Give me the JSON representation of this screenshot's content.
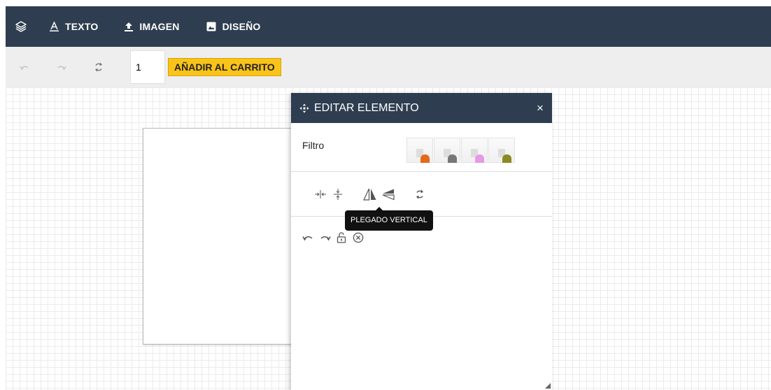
{
  "nav": {
    "layers_icon": "layers-icon",
    "items": [
      {
        "label": "TEXTO",
        "icon": "text-icon"
      },
      {
        "label": "IMAGEN",
        "icon": "upload-icon"
      },
      {
        "label": "DISEÑO",
        "icon": "image-icon"
      }
    ]
  },
  "toolbar": {
    "undo_icon": "undo-icon",
    "redo_icon": "redo-icon",
    "reset_icon": "refresh-icon",
    "quantity_value": "1",
    "cart_label": "AÑADIR AL CARRITO"
  },
  "panel": {
    "title": "EDITAR ELEMENTO",
    "close_label": "×",
    "filter_label": "Filtro",
    "filter_swatches": [
      {
        "name": "orange",
        "color": "#e66a1a"
      },
      {
        "name": "gray",
        "color": "#777777"
      },
      {
        "name": "pink",
        "color": "#e59ae8"
      },
      {
        "name": "olive",
        "color": "#8a8a22"
      }
    ],
    "tooltip": "PLEGADO VERTICAL"
  },
  "colors": {
    "navbar": "#2e3e50",
    "toolbar": "#eeeeee",
    "cart_button": "#f9c31a"
  }
}
